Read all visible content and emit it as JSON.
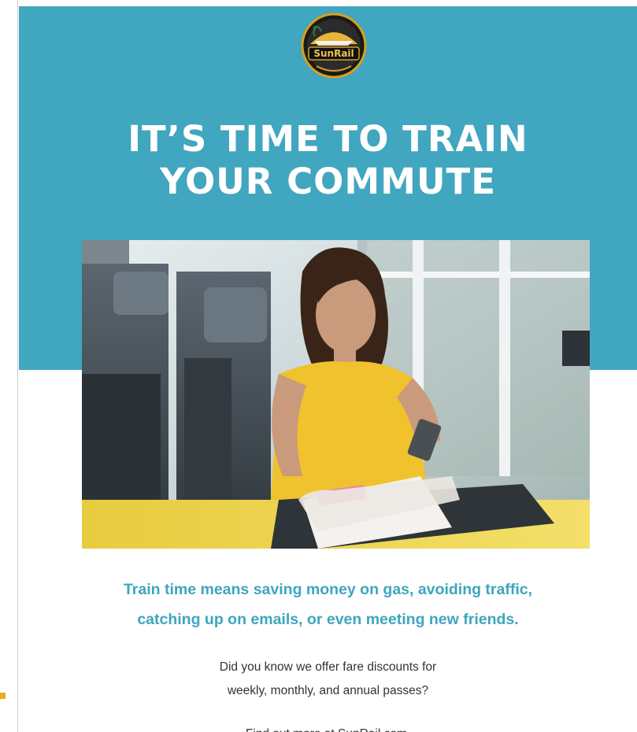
{
  "brand": {
    "logo_text": "SunRail",
    "icon": "sunrail-logo-icon"
  },
  "hero": {
    "background": "#41a6bf",
    "headline_line1": "IT’S TIME TO TRAIN",
    "headline_line2": "YOUR COMMUTE"
  },
  "photo": {
    "icon": "commuter-photo"
  },
  "tagline": {
    "line1": "Train time means saving money on gas, avoiding traffic,",
    "line2": "catching up on emails, or even meeting new friends.",
    "color": "#3fa5bf"
  },
  "body": {
    "line1": "Did you know we offer fare discounts for",
    "line2": "weekly, monthly, and annual passes?"
  },
  "cta": {
    "text": "Find out more at SunRail.com."
  }
}
